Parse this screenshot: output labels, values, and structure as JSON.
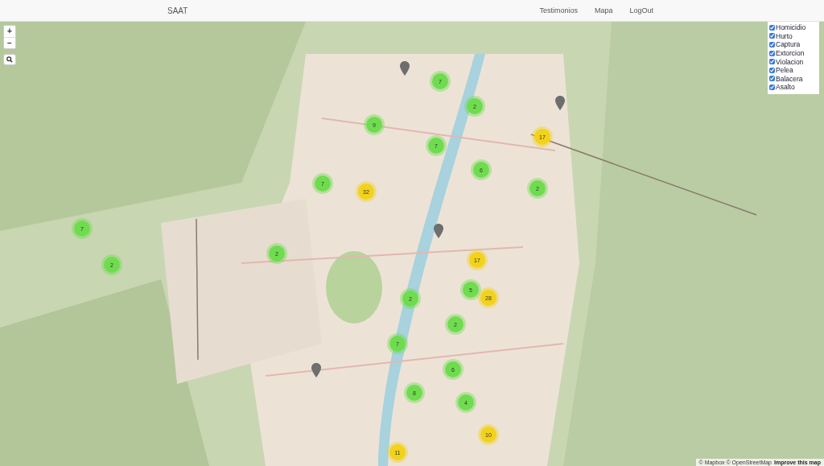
{
  "navbar": {
    "brand": "SAAT",
    "links": [
      {
        "label": "Testimonios"
      },
      {
        "label": "Mapa"
      },
      {
        "label": "LogOut"
      }
    ]
  },
  "map": {
    "zoom_controls": [
      "+",
      "−"
    ],
    "markers": [
      {
        "kind": "cluster",
        "count": "7",
        "color": "#6fdc4f"
      },
      {
        "kind": "cluster",
        "count": "2",
        "color": "#6fdc4f"
      },
      {
        "kind": "cluster",
        "count": "9",
        "color": "#6fdc4f"
      },
      {
        "kind": "cluster",
        "count": "7",
        "color": "#6fdc4f"
      },
      {
        "kind": "cluster",
        "count": "17",
        "color": "#f2d21b"
      },
      {
        "kind": "cluster",
        "count": "6",
        "color": "#6fdc4f"
      },
      {
        "kind": "cluster",
        "count": "2",
        "color": "#6fdc4f"
      },
      {
        "kind": "cluster",
        "count": "7",
        "color": "#6fdc4f"
      },
      {
        "kind": "cluster",
        "count": "32",
        "color": "#f2d21b"
      },
      {
        "kind": "cluster",
        "count": "7",
        "color": "#6fdc4f"
      },
      {
        "kind": "cluster",
        "count": "2",
        "color": "#6fdc4f"
      },
      {
        "kind": "cluster",
        "count": "2",
        "color": "#6fdc4f"
      },
      {
        "kind": "cluster",
        "count": "17",
        "color": "#f2d21b"
      },
      {
        "kind": "cluster",
        "count": "5",
        "color": "#6fdc4f"
      },
      {
        "kind": "cluster",
        "count": "28",
        "color": "#f2d21b"
      },
      {
        "kind": "cluster",
        "count": "2",
        "color": "#6fdc4f"
      },
      {
        "kind": "cluster",
        "count": "2",
        "color": "#6fdc4f"
      },
      {
        "kind": "cluster",
        "count": "7",
        "color": "#6fdc4f"
      },
      {
        "kind": "cluster",
        "count": "6",
        "color": "#6fdc4f"
      },
      {
        "kind": "cluster",
        "count": "8",
        "color": "#6fdc4f"
      },
      {
        "kind": "cluster",
        "count": "4",
        "color": "#6fdc4f"
      },
      {
        "kind": "cluster",
        "count": "10",
        "color": "#f2d21b"
      },
      {
        "kind": "cluster",
        "count": "11",
        "color": "#f2d21b"
      },
      {
        "kind": "pin"
      },
      {
        "kind": "pin"
      },
      {
        "kind": "pin"
      },
      {
        "kind": "pin"
      }
    ],
    "layers": [
      {
        "label": "Homicidio",
        "checked": true
      },
      {
        "label": "Hurto",
        "checked": true
      },
      {
        "label": "Captura",
        "checked": true
      },
      {
        "label": "Extorcion",
        "checked": true
      },
      {
        "label": "Violacion",
        "checked": true
      },
      {
        "label": "Pelea",
        "checked": true
      },
      {
        "label": "Balacera",
        "checked": true
      },
      {
        "label": "Asalto",
        "checked": true
      }
    ],
    "attribution": {
      "text": "© Mapbox © OpenStreetMap",
      "link": "Improve this map"
    }
  }
}
